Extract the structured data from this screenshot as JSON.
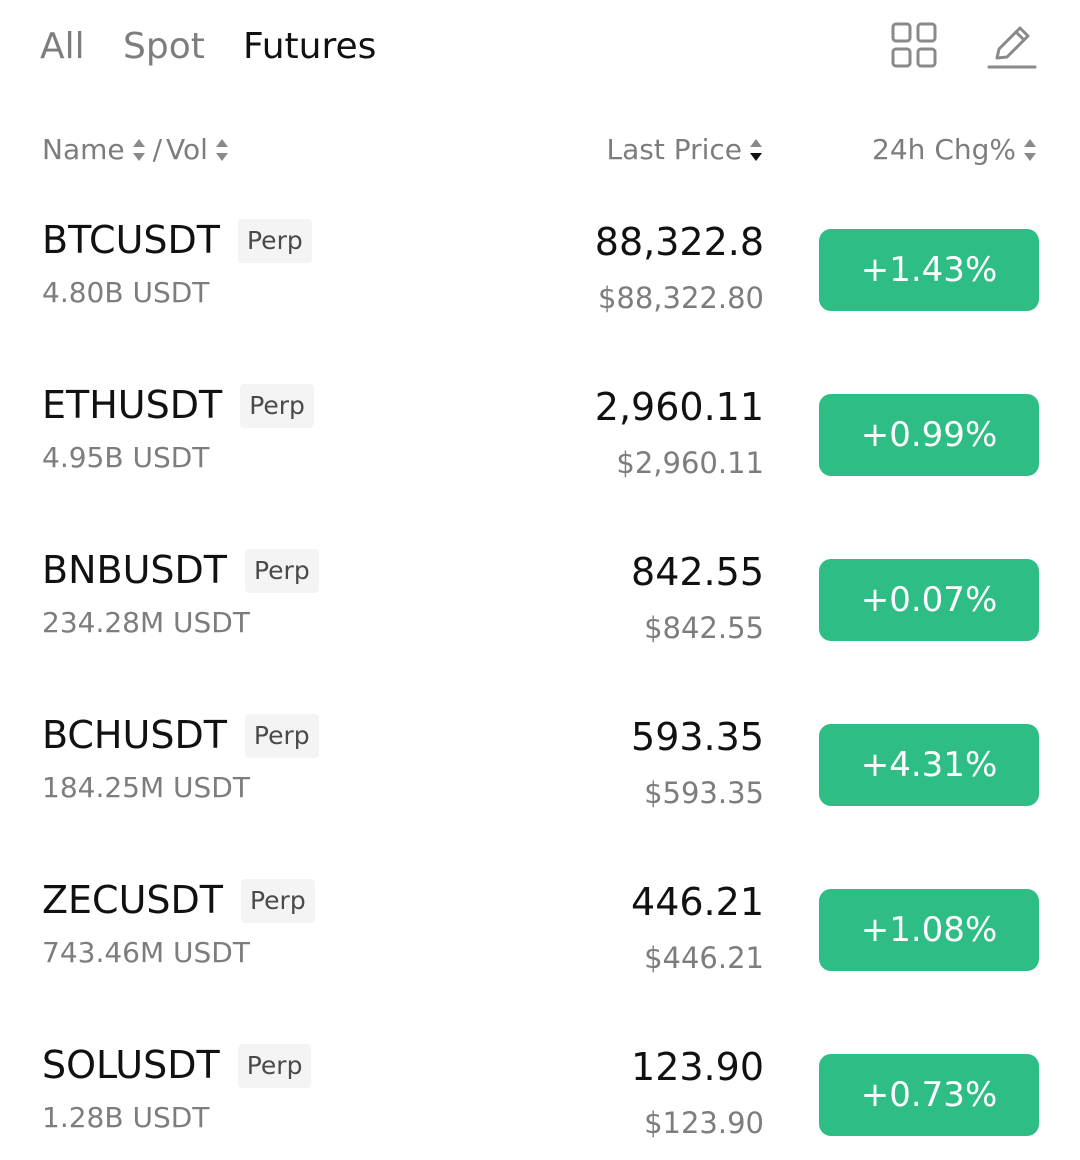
{
  "tabs": [
    {
      "label": "All",
      "active": false
    },
    {
      "label": "Spot",
      "active": false
    },
    {
      "label": "Futures",
      "active": true
    }
  ],
  "toolbar": {
    "grid_icon": "grid-view-icon",
    "edit_icon": "edit-pencil-icon"
  },
  "columns": {
    "name": "Name",
    "separator": "/",
    "vol": "Vol",
    "last_price": "Last Price",
    "change": "24h Chg%"
  },
  "colors": {
    "up": "#2ebd85",
    "text_primary": "#111111",
    "text_secondary": "#7d7d7d"
  },
  "rows": [
    {
      "symbol": "BTCUSDT",
      "tag": "Perp",
      "volume": "4.80B USDT",
      "price": "88,322.8",
      "fiat": "$88,322.80",
      "change": "+1.43%"
    },
    {
      "symbol": "ETHUSDT",
      "tag": "Perp",
      "volume": "4.95B USDT",
      "price": "2,960.11",
      "fiat": "$2,960.11",
      "change": "+0.99%"
    },
    {
      "symbol": "BNBUSDT",
      "tag": "Perp",
      "volume": "234.28M USDT",
      "price": "842.55",
      "fiat": "$842.55",
      "change": "+0.07%"
    },
    {
      "symbol": "BCHUSDT",
      "tag": "Perp",
      "volume": "184.25M USDT",
      "price": "593.35",
      "fiat": "$593.35",
      "change": "+4.31%"
    },
    {
      "symbol": "ZECUSDT",
      "tag": "Perp",
      "volume": "743.46M USDT",
      "price": "446.21",
      "fiat": "$446.21",
      "change": "+1.08%"
    },
    {
      "symbol": "SOLUSDT",
      "tag": "Perp",
      "volume": "1.28B USDT",
      "price": "123.90",
      "fiat": "$123.90",
      "change": "+0.73%"
    }
  ]
}
